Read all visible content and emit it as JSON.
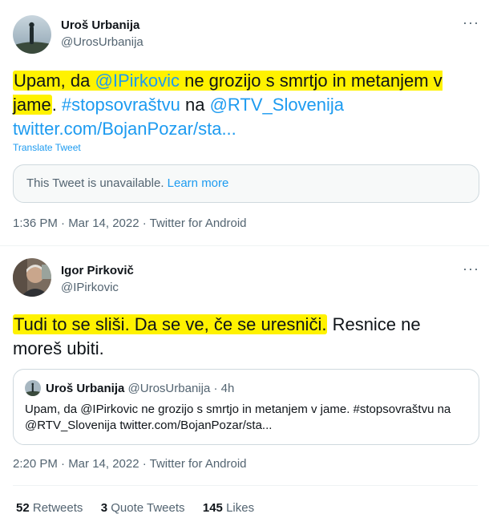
{
  "tweet1": {
    "display_name": "Uroš Urbanija",
    "handle": "@UrosUrbanija",
    "more": "···",
    "text": {
      "p1": "Upam, da ",
      "mention": "@IPirkovic",
      "p2": " ne grozijo s smrtjo in metanjem v jame",
      "p3": ". ",
      "hashtag": "#stopsovraštvu",
      "p4": " na ",
      "mention2": "@RTV_Slovenija",
      "link": "twitter.com/BojanPozar/sta..."
    },
    "translate_label": "Translate Tweet",
    "unavailable_text": "This Tweet is unavailable.",
    "unavailable_link": "Learn more",
    "timestamp": "1:36 PM · Mar 14, 2022 · Twitter for Android"
  },
  "tweet2": {
    "display_name": "Igor Pirkovič",
    "handle": "@IPirkovic",
    "more": "···",
    "text": {
      "highlighted": "Tudi to se sliši. Da se ve, če se uresniči.",
      "rest": " Resnice ne moreš ubiti."
    },
    "quote": {
      "display_name": "Uroš Urbanija",
      "handle_time": "@UrosUrbanija · 4h",
      "text": "Upam, da @IPirkovic ne grozijo s smrtjo in metanjem v jame. #stopsovraštvu na @RTV_Slovenija twitter.com/BojanPozar/sta..."
    },
    "timestamp": "2:20 PM · Mar 14, 2022 · Twitter for Android",
    "stats": {
      "retweets_count": "52",
      "retweets_label": "Retweets",
      "quotes_count": "3",
      "quotes_label": "Quote Tweets",
      "likes_count": "145",
      "likes_label": "Likes"
    }
  },
  "colors": {
    "link": "#1d9bf0",
    "highlight": "#fff200",
    "text": "#0f1419",
    "secondary": "#536471"
  }
}
